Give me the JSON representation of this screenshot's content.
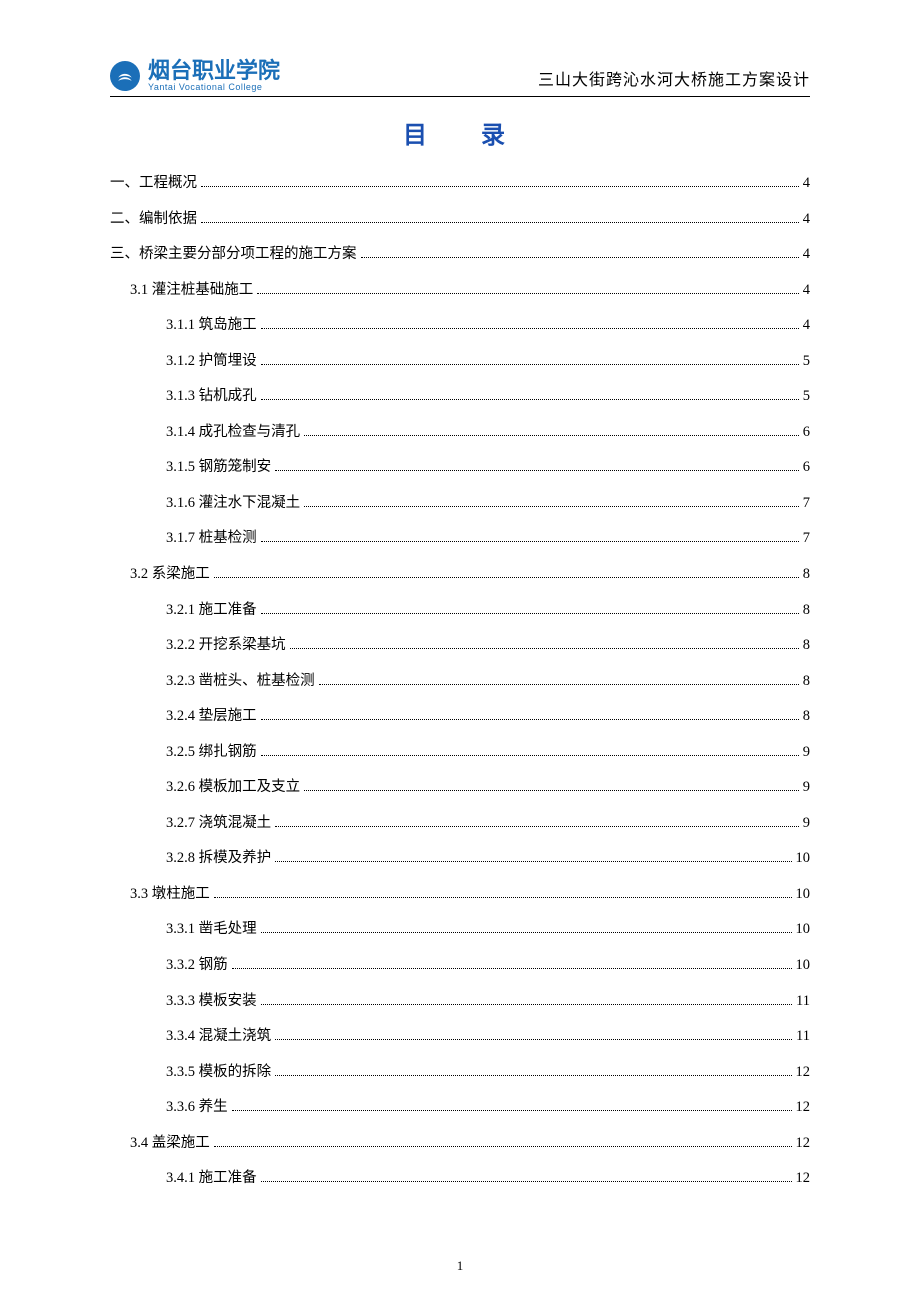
{
  "header": {
    "inst_cn": "烟台职业学院",
    "inst_en": "Yantai Vocational College",
    "doc_title": "三山大街跨沁水河大桥施工方案设计"
  },
  "toc_heading": "目  录",
  "page_number": "1",
  "toc": [
    {
      "level": 0,
      "label": "一、工程概况",
      "page": "4"
    },
    {
      "level": 0,
      "label": "二、编制依据",
      "page": "4"
    },
    {
      "level": 0,
      "label": "三、桥梁主要分部分项工程的施工方案",
      "page": "4"
    },
    {
      "level": 1,
      "label": "3.1 灌注桩基础施工",
      "page": "4"
    },
    {
      "level": 2,
      "label": "3.1.1 筑岛施工",
      "page": "4"
    },
    {
      "level": 2,
      "label": "3.1.2  护筒埋设",
      "page": "5"
    },
    {
      "level": 2,
      "label": "3.1.3  钻机成孔",
      "page": "5"
    },
    {
      "level": 2,
      "label": "3.1.4  成孔检查与清孔",
      "page": "6"
    },
    {
      "level": 2,
      "label": "3.1.5  钢筋笼制安",
      "page": "6"
    },
    {
      "level": 2,
      "label": "3.1.6 灌注水下混凝土",
      "page": "7"
    },
    {
      "level": 2,
      "label": "3.1.7 桩基检测",
      "page": "7"
    },
    {
      "level": 1,
      "label": "3.2 系梁施工",
      "page": "8"
    },
    {
      "level": 2,
      "label": "3.2.1 施工准备",
      "page": "8"
    },
    {
      "level": 2,
      "label": "3.2.2  开挖系梁基坑",
      "page": "8"
    },
    {
      "level": 2,
      "label": "3.2.3 凿桩头、桩基检测",
      "page": "8"
    },
    {
      "level": 2,
      "label": "3.2.4 垫层施工",
      "page": "8"
    },
    {
      "level": 2,
      "label": "3.2.5 绑扎钢筋",
      "page": "9"
    },
    {
      "level": 2,
      "label": "3.2.6 模板加工及支立",
      "page": "9"
    },
    {
      "level": 2,
      "label": "3.2.7 浇筑混凝土",
      "page": "9"
    },
    {
      "level": 2,
      "label": "3.2.8 拆模及养护",
      "page": "10"
    },
    {
      "level": 1,
      "label": "3.3 墩柱施工",
      "page": "10"
    },
    {
      "level": 2,
      "label": "3.3.1 凿毛处理",
      "page": "10"
    },
    {
      "level": 2,
      "label": "3.3.2 钢筋",
      "page": "10"
    },
    {
      "level": 2,
      "label": "3.3.3 模板安装",
      "page": "11"
    },
    {
      "level": 2,
      "label": "3.3.4 混凝土浇筑",
      "page": "11"
    },
    {
      "level": 2,
      "label": "3.3.5 模板的拆除",
      "page": "12"
    },
    {
      "level": 2,
      "label": "3.3.6 养生",
      "page": "12"
    },
    {
      "level": 1,
      "label": "3.4 盖梁施工",
      "page": "12"
    },
    {
      "level": 2,
      "label": "3.4.1 施工准备",
      "page": "12"
    }
  ]
}
